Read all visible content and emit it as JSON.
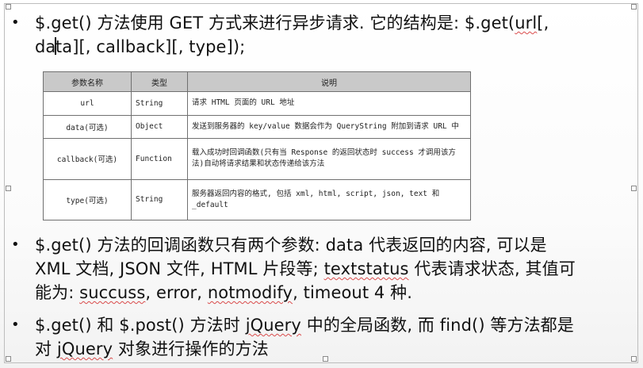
{
  "bullets": [
    {
      "parts": [
        "$.get() 方法使用 GET 方式来进行异步请求. 它的结构是: $.get(",
        "url",
        "[,",
        "da",
        "ta][, callback][, type]);"
      ]
    },
    {
      "line1": "$.get() 方法的回调函数只有两个参数: data 代表返回的内容, 可以是",
      "line2": "XML 文档, JSON 文件, HTML 片段等; ",
      "line2_sq": "textstatus",
      "line2_end": " 代表请求状态, 其值可",
      "line3_start": "能为: ",
      "line3_sq1": "succuss",
      "line3_mid1": ", error, ",
      "line3_sq2": "notmodify",
      "line3_end": ", timeout 4 种."
    },
    {
      "line1_a": "$.get()  和 $.post() 方法时 ",
      "line1_sq": "jQuery",
      "line1_b": " 中的全局函数, 而 find() 等方法都是",
      "line2_a": "对 ",
      "line2_sq": "jQuery",
      "line2_b": " 对象进行操作的方法"
    }
  ],
  "table": {
    "headers": [
      "参数名称",
      "类型",
      "说明"
    ],
    "rows": [
      [
        "url",
        "String",
        "请求 HTML 页面的 URL 地址"
      ],
      [
        "data(可选)",
        "Object",
        "发送到服务器的 key/value 数据会作为 QueryString 附加到请求 URL 中"
      ],
      [
        "callback(可选)",
        "Function",
        "载入成功时回调函数(只有当 Response 的返回状态时 success 才调用该方法)自动将请求结果和状态传递给该方法"
      ],
      [
        "type(可选)",
        "String",
        "服务器返回内容的格式, 包括 xml, html, script, json, text 和 _default"
      ]
    ]
  }
}
